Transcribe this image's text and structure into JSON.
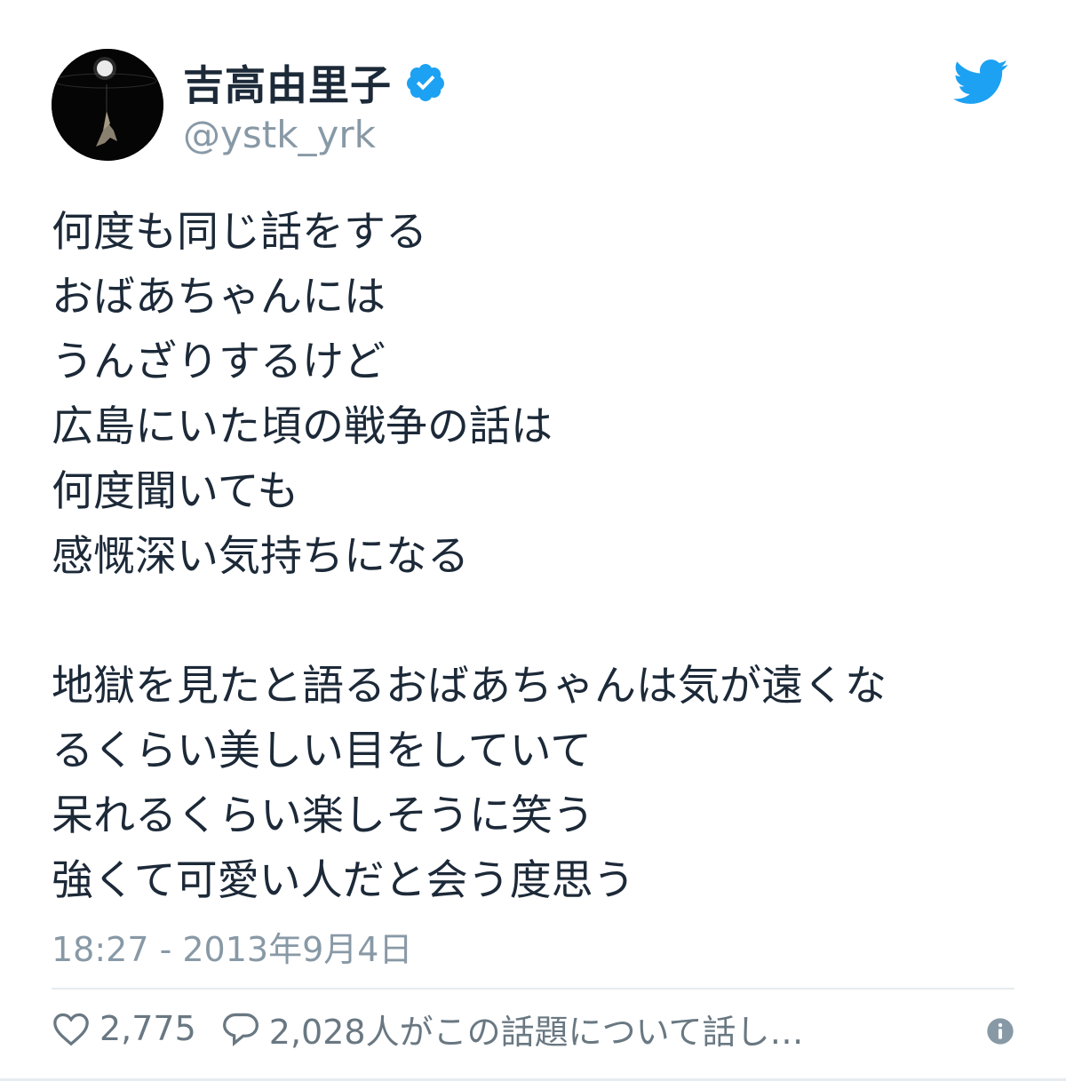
{
  "author": {
    "display_name": "吉高由里子",
    "handle": "@ystk_yrk",
    "verified": true,
    "avatar_icon": "profile-avatar"
  },
  "brand": {
    "icon": "twitter-bird-icon",
    "color": "#1da1f2"
  },
  "tweet": {
    "lines": [
      "何度も同じ話をする",
      "おばあちゃんには",
      "うんざりするけど",
      "広島にいた頃の戦争の話は",
      "何度聞いても",
      "感慨深い気持ちになる",
      "",
      "地獄を見たと語るおばあちゃんは気が遠くな",
      "るくらい美しい目をしていて",
      "呆れるくらい楽しそうに笑う",
      "強くて可愛い人だと会う度思う"
    ],
    "timestamp": "18:27 - 2013年9月4日"
  },
  "actions": {
    "like_icon": "heart-icon",
    "like_count": "2,775",
    "reply_icon": "speech-bubble-icon",
    "reply_text": "2,028人がこの話題について話し…",
    "info_icon": "info-icon"
  },
  "colors": {
    "text": "#1c2938",
    "muted": "#8899a6",
    "verified": "#1da1f2"
  }
}
